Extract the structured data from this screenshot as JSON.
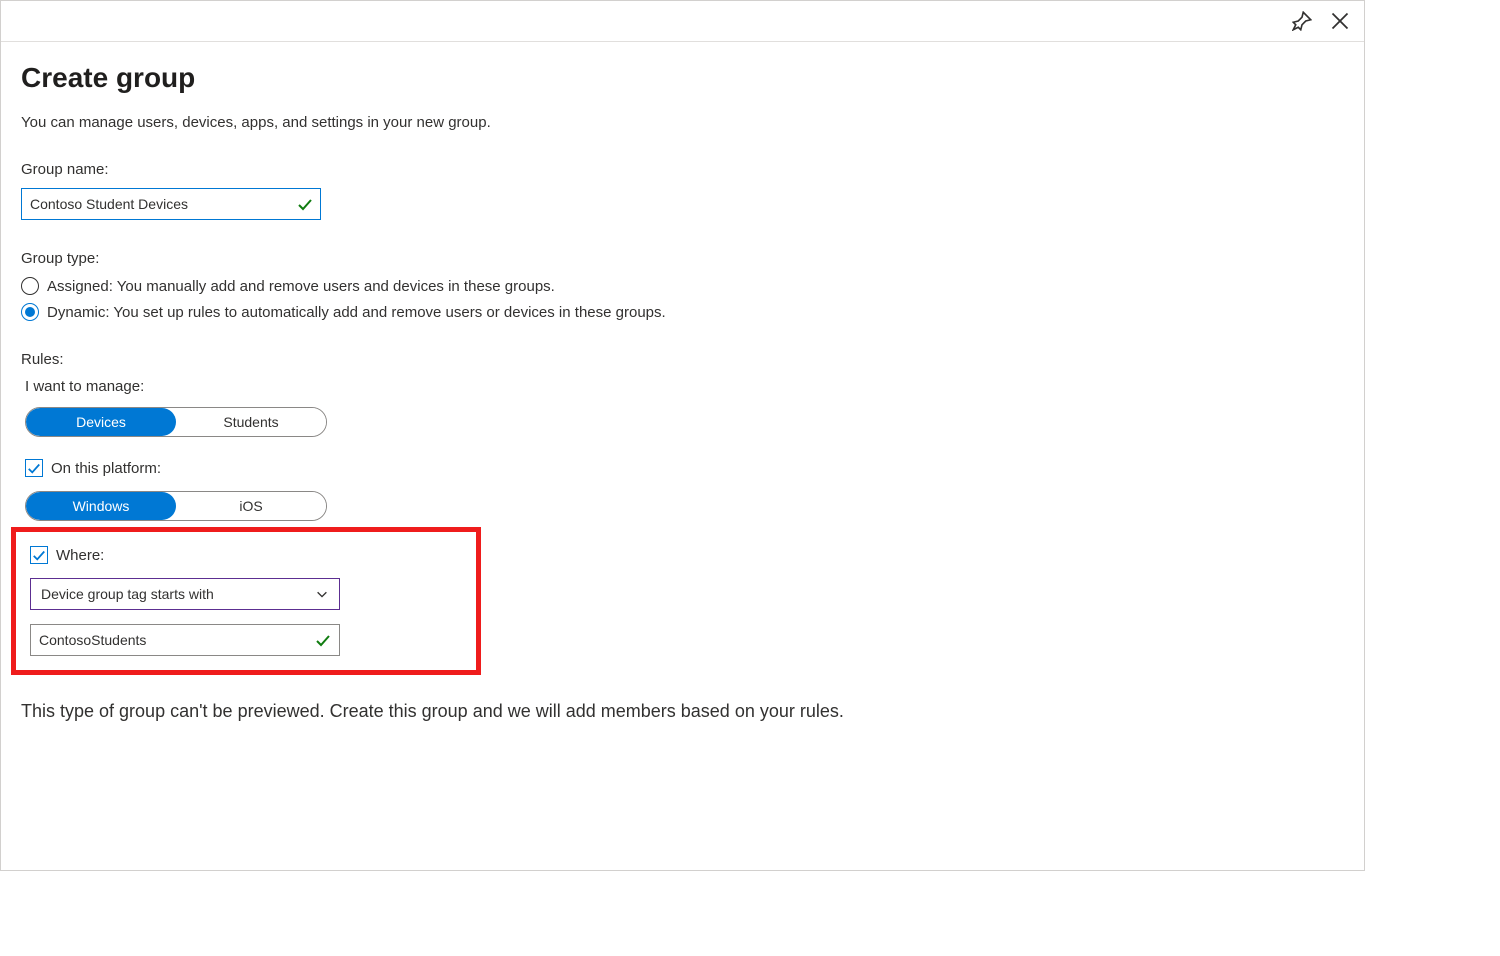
{
  "header": {
    "title": "Create group",
    "subtitle": "You can manage users, devices, apps, and settings in your new group."
  },
  "groupName": {
    "label": "Group name:",
    "value": "Contoso Student Devices"
  },
  "groupType": {
    "label": "Group type:",
    "options": [
      {
        "label": "Assigned: You manually add and remove users and devices in these groups.",
        "selected": false
      },
      {
        "label": "Dynamic: You set up rules to automatically add and remove users or devices in these groups.",
        "selected": true
      }
    ]
  },
  "rules": {
    "label": "Rules:",
    "manageLabel": "I want to manage:",
    "manageOptions": [
      {
        "label": "Devices",
        "active": true
      },
      {
        "label": "Students",
        "active": false
      }
    ],
    "platformCheckboxLabel": "On this platform:",
    "platformOptions": [
      {
        "label": "Windows",
        "active": true
      },
      {
        "label": "iOS",
        "active": false
      }
    ],
    "whereCheckboxLabel": "Where:",
    "whereDropdown": "Device group tag starts with",
    "whereValue": "ContosoStudents"
  },
  "footerNote": "This type of group can't be previewed. Create this group and we will add members based on your rules."
}
